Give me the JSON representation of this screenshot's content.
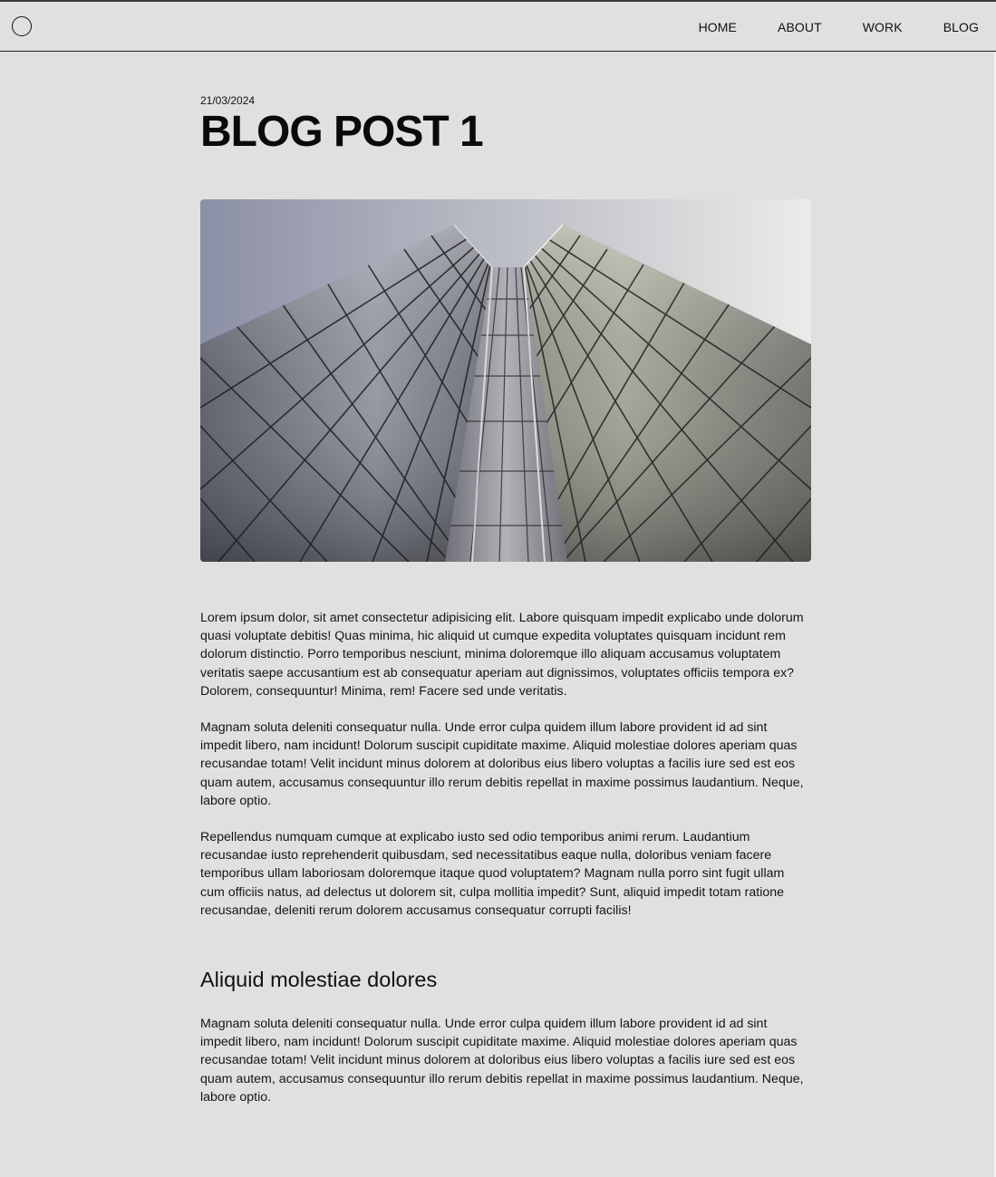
{
  "header": {
    "logo_icon": "circle-logo-icon",
    "nav": [
      {
        "label": "HOME"
      },
      {
        "label": "ABOUT"
      },
      {
        "label": "WORK"
      },
      {
        "label": "BLOG"
      }
    ]
  },
  "post": {
    "date": "21/03/2024",
    "title": "BLOG POST 1",
    "image_subject": "skyscraper-looking-up",
    "paragraphs": [
      "Lorem ipsum dolor, sit amet consectetur adipisicing elit. Labore quisquam impedit explicabo unde dolorum quasi voluptate debitis! Quas minima, hic aliquid ut cumque expedita voluptates quisquam incidunt rem dolorum distinctio. Porro temporibus nesciunt, minima doloremque illo aliquam accusamus voluptatem veritatis saepe accusantium est ab consequatur aperiam aut dignissimos, voluptates officiis tempora ex? Dolorem, consequuntur! Minima, rem! Facere sed unde veritatis.",
      "Magnam soluta deleniti consequatur nulla. Unde error culpa quidem illum labore provident id ad sint impedit libero, nam incidunt! Dolorum suscipit cupiditate maxime. Aliquid molestiae dolores aperiam quas recusandae totam! Velit incidunt minus dolorem at doloribus eius libero voluptas a facilis iure sed est eos quam autem, accusamus consequuntur illo rerum debitis repellat in maxime possimus laudantium. Neque, labore optio.",
      "Repellendus numquam cumque at explicabo iusto sed odio temporibus animi rerum. Laudantium recusandae iusto reprehenderit quibusdam, sed necessitatibus eaque nulla, doloribus veniam facere temporibus ullam laboriosam doloremque itaque quod voluptatem? Magnam nulla porro sint fugit ullam cum officiis natus, ad delectus ut dolorem sit, culpa mollitia impedit? Sunt, aliquid impedit totam ratione recusandae, deleniti rerum dolorem accusamus consequatur corrupti facilis!"
    ],
    "section": {
      "heading": "Aliquid molestiae dolores",
      "paragraph": "Magnam soluta deleniti consequatur nulla. Unde error culpa quidem illum labore provident id ad sint impedit libero, nam incidunt! Dolorum suscipit cupiditate maxime. Aliquid molestiae dolores aperiam quas recusandae totam! Velit incidunt minus dolorem at doloribus eius libero voluptas a facilis iure sed est eos quam autem, accusamus consequuntur illo rerum debitis repellat in maxime possimus laudantium. Neque, labore optio."
    }
  },
  "colors": {
    "background": "#e0e0e0",
    "text": "#111111",
    "rule": "#222222"
  }
}
